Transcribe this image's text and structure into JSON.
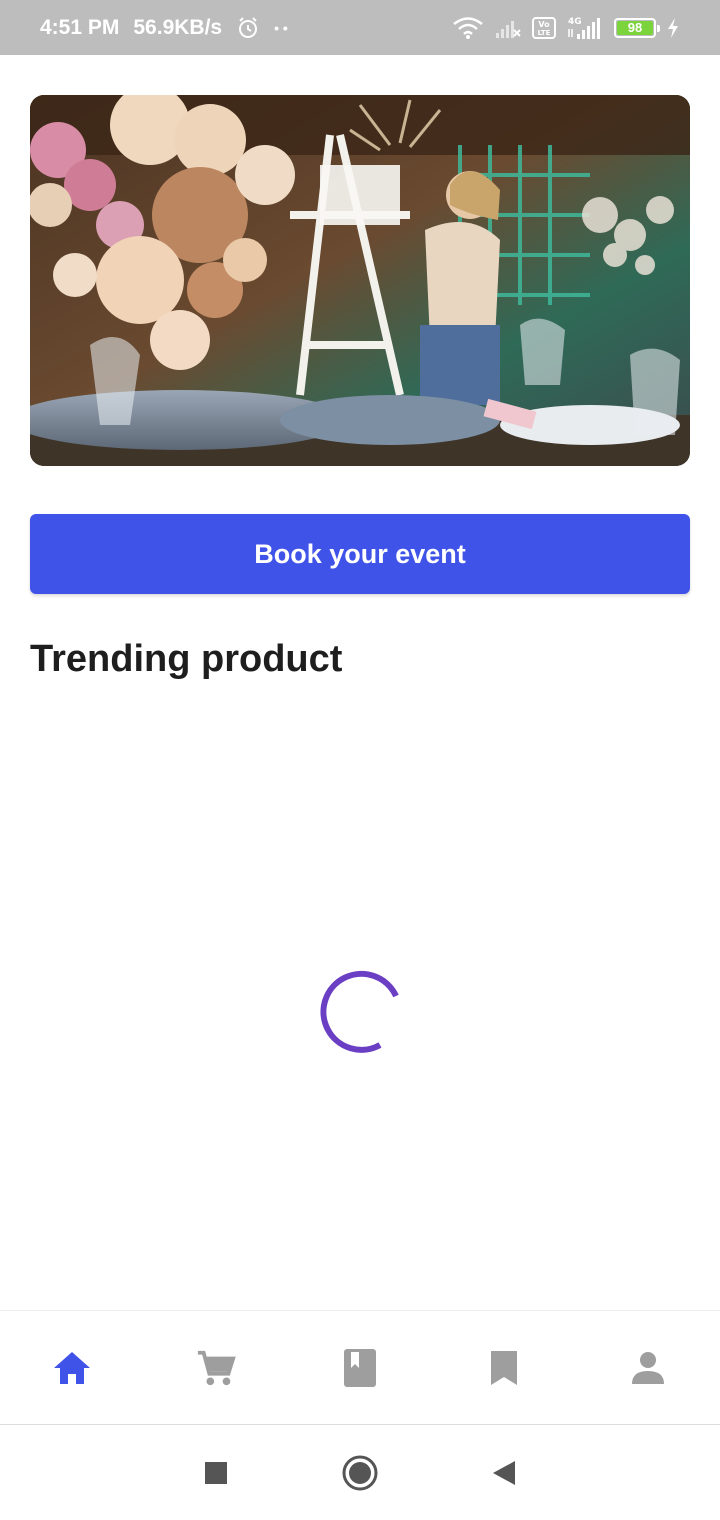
{
  "status_bar": {
    "time": "4:51 PM",
    "net_speed": "56.9KB/s",
    "dots": "• •",
    "battery_level": "98",
    "icons": [
      "alarm-icon",
      "wifi-icon",
      "signal-x-icon",
      "volte-icon",
      "4g-signal-icon",
      "battery-icon",
      "charging-icon"
    ]
  },
  "hero": {
    "image_alt": "Event decoration with balloons"
  },
  "book_button": {
    "label": "Book your event"
  },
  "trending": {
    "title": "Trending product"
  },
  "spinner": {
    "color": "#6a3fc4"
  },
  "bottom_nav": {
    "active_color": "#4053e8",
    "inactive_color": "#9e9e9e",
    "items": [
      {
        "icon": "home-icon",
        "active": true
      },
      {
        "icon": "cart-icon",
        "active": false
      },
      {
        "icon": "book-icon",
        "active": false
      },
      {
        "icon": "bookmark-icon",
        "active": false
      },
      {
        "icon": "profile-icon",
        "active": false
      }
    ]
  },
  "system_nav": {
    "items": [
      "recents-icon",
      "home-circle-icon",
      "back-icon"
    ]
  }
}
